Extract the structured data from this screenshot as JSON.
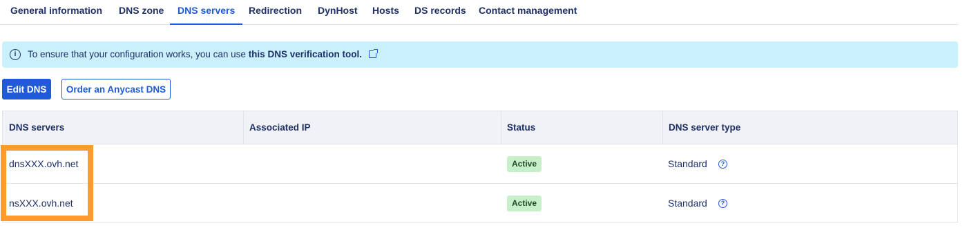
{
  "tabs": [
    {
      "label": "General information"
    },
    {
      "label": "DNS zone"
    },
    {
      "label": "DNS servers",
      "active": true
    },
    {
      "label": "Redirection"
    },
    {
      "label": "DynHost"
    },
    {
      "label": "Hosts"
    },
    {
      "label": "DS records"
    },
    {
      "label": "Contact management"
    }
  ],
  "banner": {
    "icon": "info-icon",
    "text": "To ensure that your configuration works, you can use ",
    "link": "this DNS verification tool.",
    "link_icon": "external-link-icon"
  },
  "buttons": {
    "edit": "Edit DNS",
    "order": "Order an Anycast DNS"
  },
  "table": {
    "columns": [
      "DNS servers",
      "Associated IP",
      "Status",
      "DNS server type"
    ],
    "rows": [
      {
        "server": "dnsXXX.ovh.net",
        "ip": "",
        "status": "Active",
        "type": "Standard"
      },
      {
        "server": "nsXXX.ovh.net",
        "ip": "",
        "status": "Active",
        "type": "Standard"
      }
    ]
  },
  "colors": {
    "accent": "#1f5bd8",
    "text": "#1e2f68",
    "banner_bg": "#c9f0fb",
    "status_bg": "#c8f0c8",
    "highlight": "#ff9a2e"
  }
}
